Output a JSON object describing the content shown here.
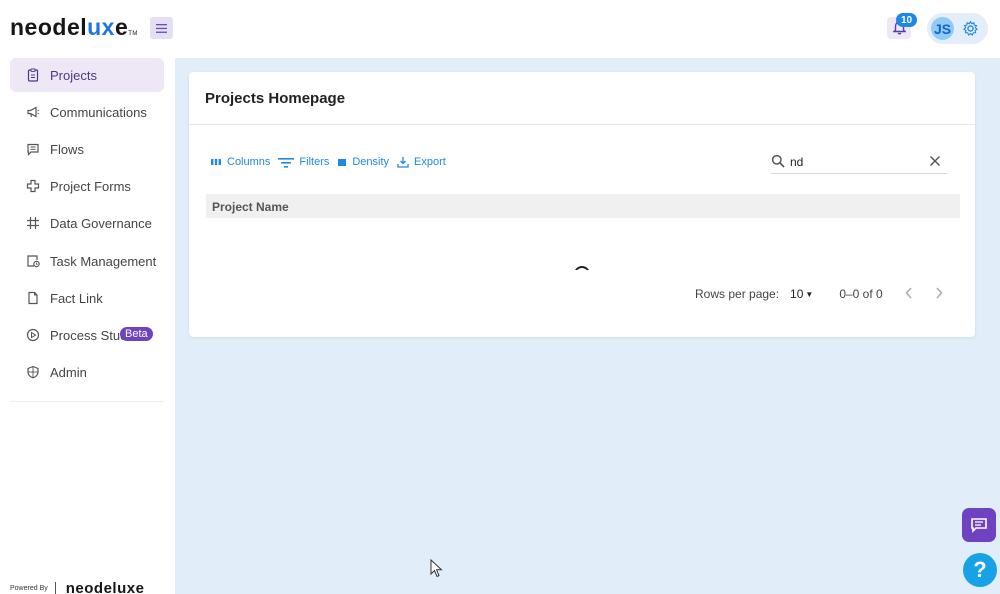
{
  "header": {
    "logo_main": "neodel",
    "logo_accent": "ux",
    "logo_end": "e",
    "logo_tm": "TM",
    "notification_count": "10",
    "user_initials": "JS"
  },
  "sidebar": {
    "items": [
      {
        "label": "Projects",
        "icon": "clipboard-icon",
        "active": true
      },
      {
        "label": "Communications",
        "icon": "megaphone-icon"
      },
      {
        "label": "Flows",
        "icon": "chat-lines-icon"
      },
      {
        "label": "Project Forms",
        "icon": "puzzle-icon"
      },
      {
        "label": "Data Governance",
        "icon": "grid-hash-icon"
      },
      {
        "label": "Task Management",
        "icon": "task-clock-icon"
      },
      {
        "label": "Fact Link",
        "icon": "document-icon"
      },
      {
        "label": "Process Stud",
        "icon": "play-circle-icon",
        "badge": "Beta"
      },
      {
        "label": "Admin",
        "icon": "shield-icon"
      }
    ],
    "powered_by": "Powered By",
    "powered_logo": "neodeluxe"
  },
  "main": {
    "card_title": "Projects Homepage",
    "toolbar": {
      "columns": "Columns",
      "filters": "Filters",
      "density": "Density",
      "export": "Export"
    },
    "search_value": "nd",
    "grid": {
      "columns": [
        "Project Name"
      ]
    },
    "pagination": {
      "rows_per_page_label": "Rows per page:",
      "rows_per_page": "10",
      "range": "0–0 of 0"
    }
  },
  "colors": {
    "accent_purple": "#6f42c1",
    "accent_blue": "#1e88e5",
    "main_bg": "#e1eef9"
  }
}
